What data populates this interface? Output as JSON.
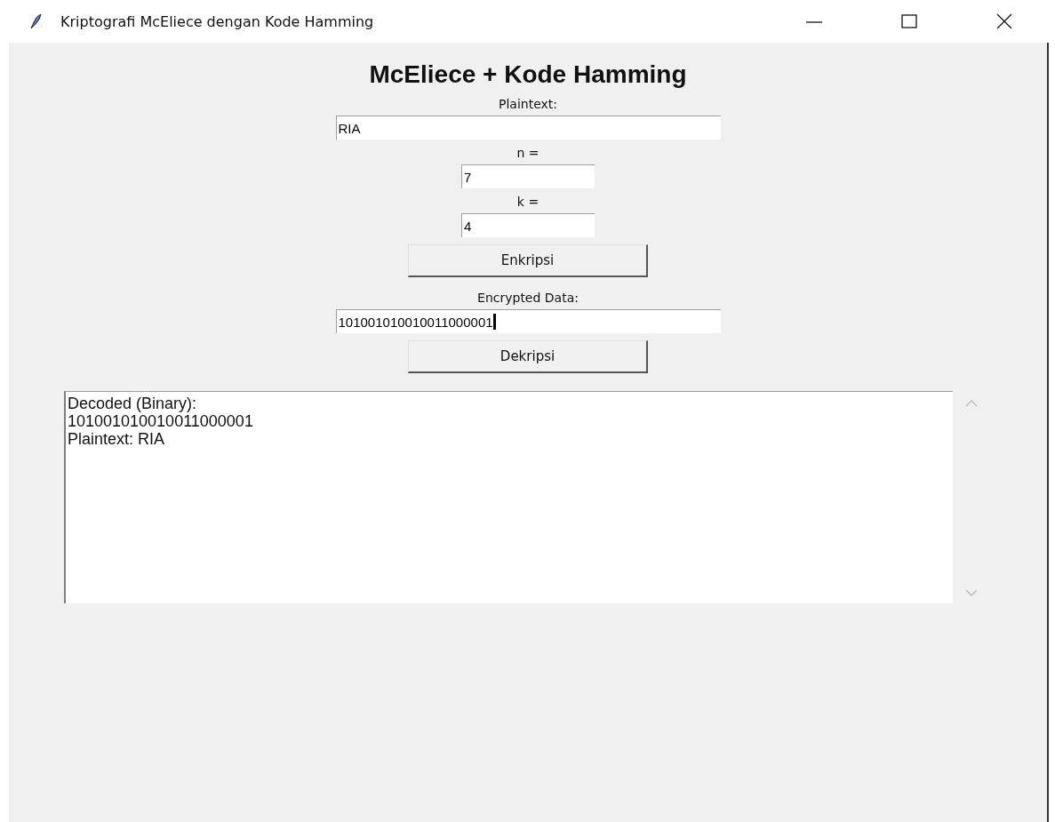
{
  "window": {
    "title": "Kriptografi McEliece dengan Kode Hamming"
  },
  "heading": "McEliece + Kode Hamming",
  "plaintext": {
    "label": "Plaintext:",
    "value": "RIA"
  },
  "n": {
    "label": "n =",
    "value": "7"
  },
  "k": {
    "label": "k =",
    "value": "4"
  },
  "encrypt_button": "Enkripsi",
  "encrypted": {
    "label": "Encrypted Data:",
    "value": "101001010010011000001"
  },
  "decrypt_button": "Dekripsi",
  "output": {
    "lines": [
      "Decoded (Binary):",
      "101001010010011000001",
      "Plaintext: RIA"
    ]
  }
}
